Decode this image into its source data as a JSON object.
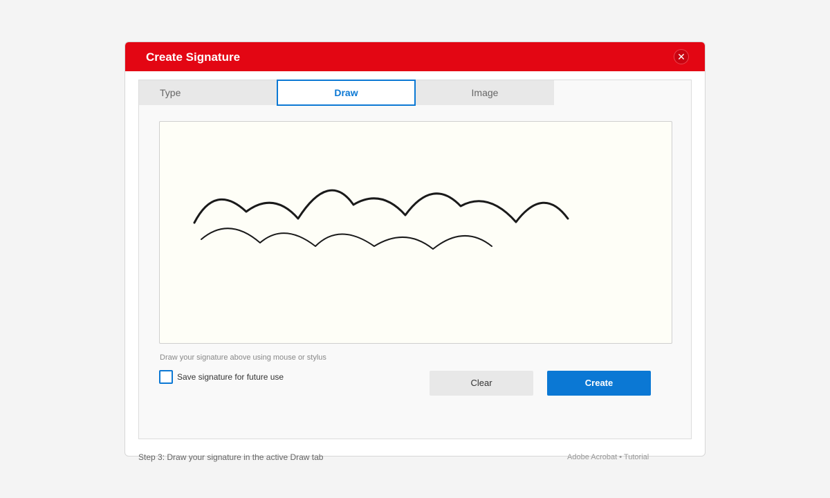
{
  "dialog": {
    "title": "Create Signature",
    "close_icon": "close-icon",
    "close_glyph": "✕"
  },
  "tabs": [
    {
      "label": "Type",
      "active": false
    },
    {
      "label": "Draw",
      "active": true
    },
    {
      "label": "Image",
      "active": false
    }
  ],
  "draw": {
    "hint": "Draw your signature above using mouse or stylus",
    "save_label": "Save signature for future use",
    "save_checked": false
  },
  "buttons": {
    "clear": "Clear",
    "create": "Create"
  },
  "footer": {
    "step": "Step 3: Draw your signature in the active Draw tab",
    "brand": "Adobe Acrobat • Tutorial"
  },
  "colors": {
    "titlebar": "#e30613",
    "accent": "#0b78d4",
    "canvas_bg": "#fefef7",
    "ink": "#1a1a1a"
  }
}
